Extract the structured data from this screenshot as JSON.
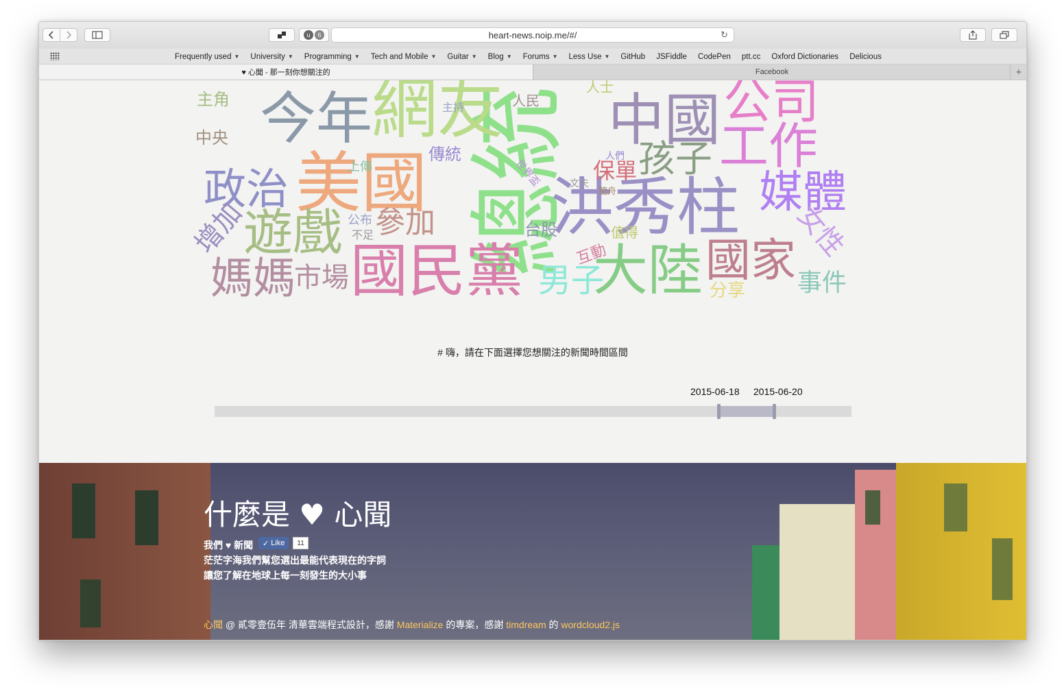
{
  "browser": {
    "url": "heart-news.noip.me/#/",
    "extension_badge": "6",
    "bookmarks": [
      {
        "label": "Frequently used",
        "has_menu": true
      },
      {
        "label": "University",
        "has_menu": true
      },
      {
        "label": "Programming",
        "has_menu": true
      },
      {
        "label": "Tech and Mobile",
        "has_menu": true
      },
      {
        "label": "Guitar",
        "has_menu": true
      },
      {
        "label": "Blog",
        "has_menu": true
      },
      {
        "label": "Forums",
        "has_menu": true
      },
      {
        "label": "Less Use",
        "has_menu": true
      },
      {
        "label": "GitHub",
        "has_menu": false
      },
      {
        "label": "JSFiddle",
        "has_menu": false
      },
      {
        "label": "CodePen",
        "has_menu": false
      },
      {
        "label": "ptt.cc",
        "has_menu": false
      },
      {
        "label": "Oxford Dictionaries",
        "has_menu": false
      },
      {
        "label": "Delicious",
        "has_menu": false
      }
    ],
    "tabs": [
      {
        "title": "♥ 心聞 - 那一刻你想關注的",
        "active": true
      },
      {
        "title": "Facebook",
        "active": false
      }
    ],
    "new_tab": "+"
  },
  "word_cloud": {
    "words": [
      "總統",
      "網友",
      "今年",
      "中國",
      "公司",
      "工作",
      "美國",
      "洪秀柱",
      "媒體",
      "政治",
      "遊戲",
      "國民黨",
      "大陸",
      "國家",
      "媽媽",
      "市場",
      "男子",
      "孩子",
      "保單",
      "參加",
      "增加",
      "台股",
      "女性",
      "事件",
      "分享",
      "互動",
      "值得",
      "傳統",
      "上傳",
      "公布",
      "不足",
      "世界盃",
      "文夫",
      "龍舟",
      "人們",
      "主角",
      "中央",
      "主持",
      "人民",
      "人士"
    ]
  },
  "selector": {
    "prompt": "# 嗨，請在下面選擇您想關注的新聞時間區間",
    "start_date": "2015-06-18",
    "end_date": "2015-06-20",
    "range_start_fraction": 0.79,
    "range_end_fraction": 0.88
  },
  "footer": {
    "title": "什麼是 ♥ 心聞",
    "line1": "我們 ♥ 新聞",
    "like_label": "Like",
    "like_count": "11",
    "line2": "茫茫字海我們幫您選出最能代表現在的字詞",
    "line3": "讓您了解在地球上每一刻發生的大小事",
    "credit": {
      "brand": "心聞",
      "t1": " @ 貳零壹伍年 清華雲端程式設計，感謝 ",
      "materialize": "Materialize",
      "t2": " 的專案，感謝 ",
      "author": "timdream",
      "t3": " 的 ",
      "lib": "wordcloud2.js"
    }
  },
  "colors": {
    "accent": "#ffc75f",
    "like_button": "#4e69a2",
    "slider_track": "#dadada",
    "slider_range": "#b9b9c8"
  }
}
